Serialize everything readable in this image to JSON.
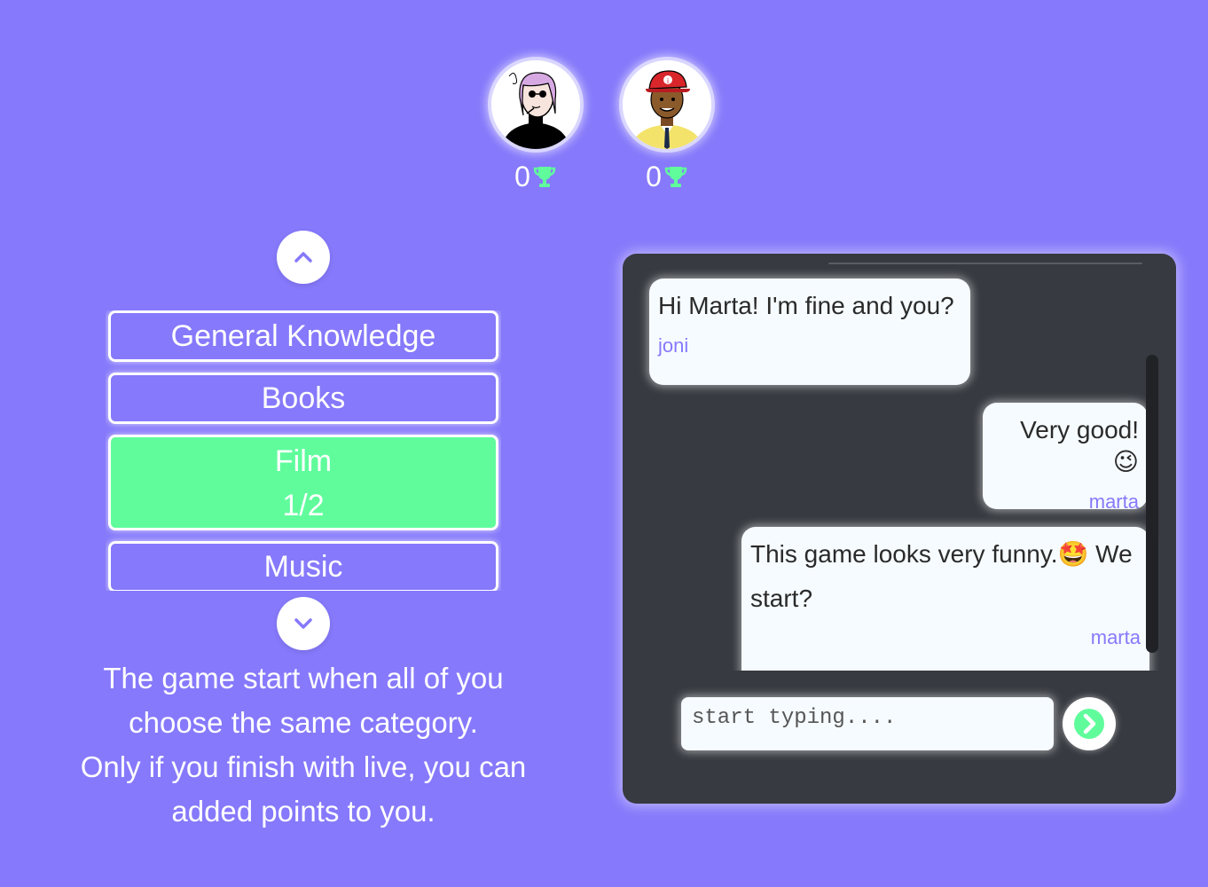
{
  "players": [
    {
      "name": "joni",
      "score": "0",
      "icon": "trophy-icon"
    },
    {
      "name": "marta",
      "score": "0",
      "icon": "trophy-icon"
    }
  ],
  "categories": {
    "up_icon": "chevron-up-icon",
    "down_icon": "chevron-down-icon",
    "items": [
      {
        "label": "General Knowledge"
      },
      {
        "label": "Books"
      },
      {
        "label": "Film",
        "progress": "1/2",
        "selected": true
      },
      {
        "label": "Music"
      }
    ]
  },
  "info": {
    "line1": "The game start when all of you",
    "line2": "choose the same category.",
    "line3": "Only if you finish with live, you can",
    "line4": "added points to you."
  },
  "chat": {
    "messages": [
      {
        "text": "Hi Marta! I'm fine and you?",
        "author": "joni"
      },
      {
        "text": "Very good! 😉",
        "author": "marta"
      },
      {
        "text": "This game looks very funny.🤩 We start?",
        "author": "marta"
      }
    ],
    "input": {
      "value": "",
      "placeholder": "start typing...."
    },
    "send_icon": "arrow-right-circle-icon"
  },
  "colors": {
    "background": "#8679fb",
    "selected_category": "#60fc9c",
    "chat_panel": "#373a40",
    "author": "#8679fb",
    "trophy": "#60fc9c"
  }
}
